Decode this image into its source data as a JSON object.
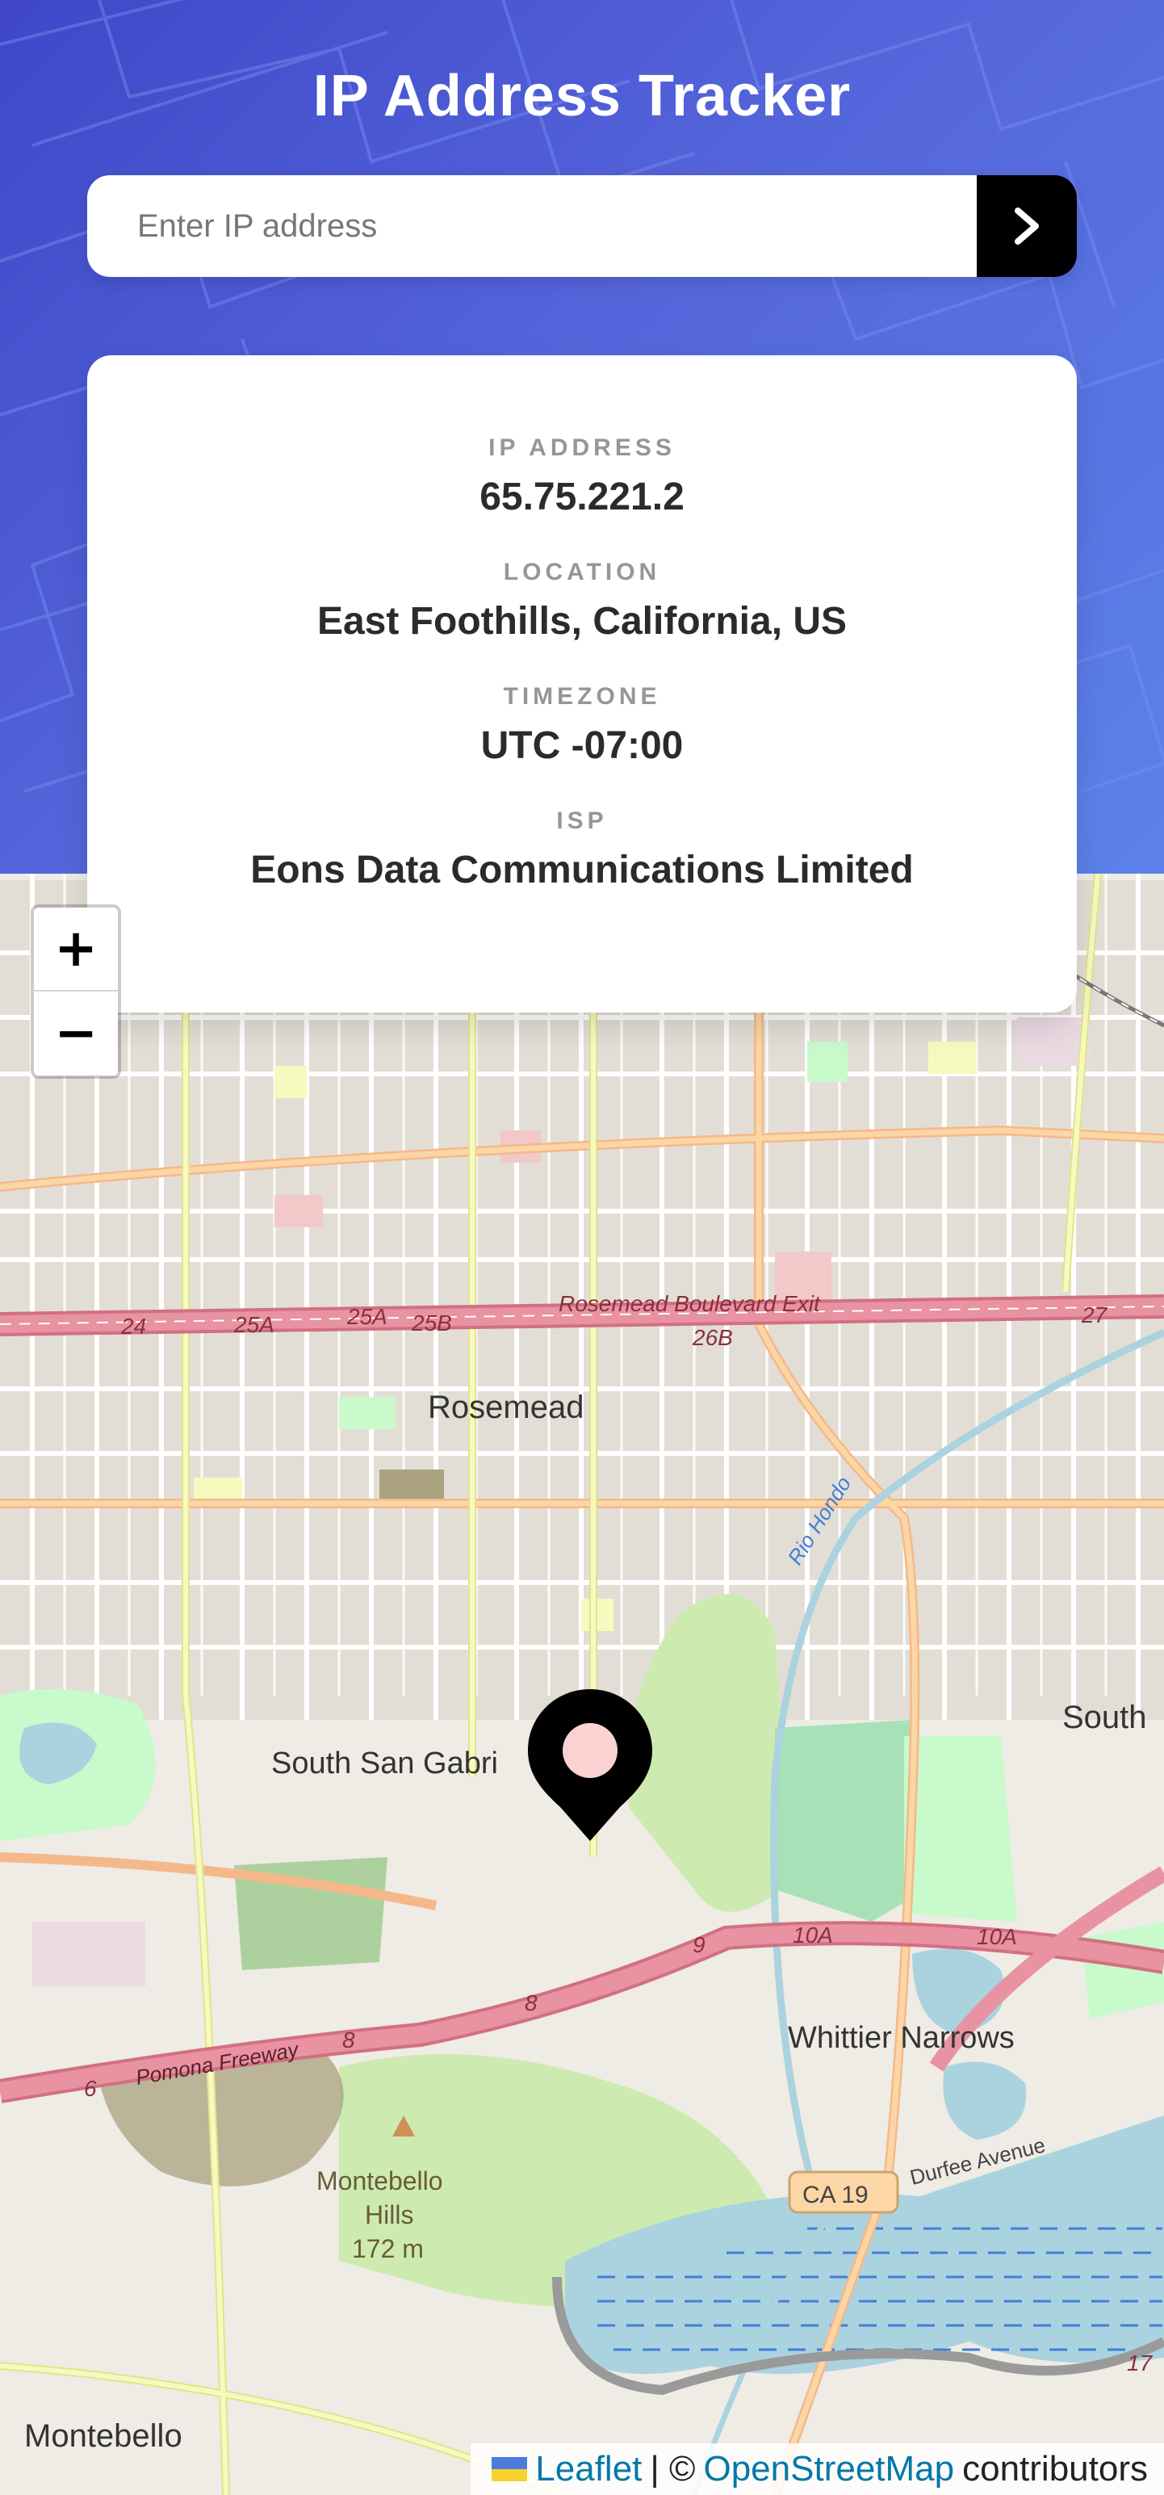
{
  "header": {
    "title": "IP Address Tracker",
    "search": {
      "placeholder": "Enter IP address",
      "value": ""
    }
  },
  "info": [
    {
      "label": "IP Address",
      "value": "65.75.221.2"
    },
    {
      "label": "Location",
      "value": "East Foothills, California, US"
    },
    {
      "label": "Timezone",
      "value": "UTC -07:00"
    },
    {
      "label": "ISP",
      "value": "Eons Data Communications Limited"
    }
  ],
  "map": {
    "zoom_in_label": "+",
    "zoom_out_label": "−",
    "labels": {
      "rosemead": "Rosemead",
      "south_san_gabriel": "South San Gabri",
      "whittier_narrows": "Whittier Narrows",
      "montebello_hills_1": "Montebello",
      "montebello_hills_2": "Hills",
      "montebello_hills_elev": "172 m",
      "montebello": "Montebello",
      "south_edge": "South",
      "rosemead_blvd_exit": "Rosemead Boulevard Exit",
      "exit_24": "24",
      "exit_25a_1": "25A",
      "exit_25a_2": "25A",
      "exit_25b": "25B",
      "exit_26b": "26B",
      "exit_27": "27",
      "pomona_freeway": "Pomona Freeway",
      "hwy_8_a": "8",
      "hwy_8_b": "8",
      "hwy_6": "6",
      "hwy_9": "9",
      "hwy_10a_1": "10A",
      "hwy_10a_2": "10A",
      "rio_hondo": "Rio Hondo",
      "durfee_avenue": "Durfee Avenue",
      "ca19": "CA 19",
      "exit_17": "17"
    },
    "attribution": {
      "leaflet": "Leaflet",
      "separator": "| ©",
      "osm": "OpenStreetMap",
      "contributors": "contributors"
    }
  },
  "colors": {
    "header_gradient_start": "#3f47c8",
    "header_gradient_end": "#5c82ea",
    "label_gray": "#969696",
    "value_dark": "#2b2b2b",
    "marker": "#000000",
    "marker_dot": "#fbd2d2",
    "highway": "#e892a2",
    "primary_road": "#fcd6a4",
    "secondary_road": "#f7fabf",
    "park": "#c8facc",
    "water": "#aad3df"
  },
  "icons": {
    "search_button": "chevron-right-icon",
    "marker": "map-pin-icon",
    "attribution_flag": "ukraine-flag-icon"
  }
}
